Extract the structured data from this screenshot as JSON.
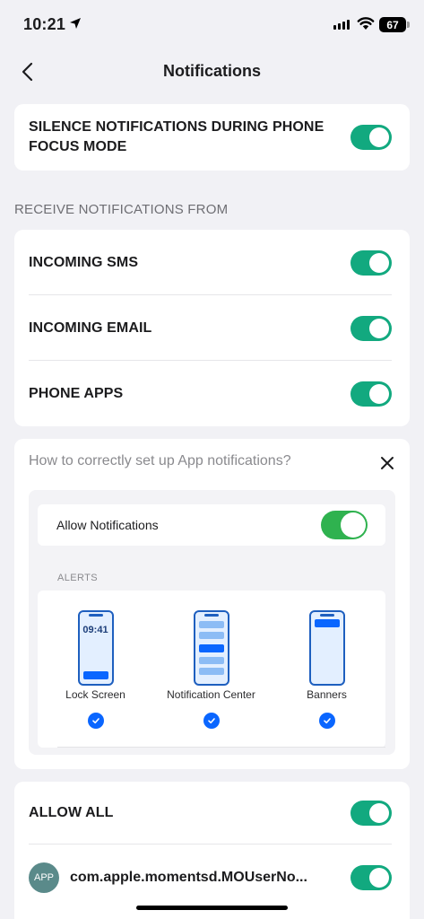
{
  "status_bar": {
    "time": "10:21",
    "battery": "67"
  },
  "nav": {
    "title": "Notifications"
  },
  "focus_mode": {
    "label": "SILENCE NOTIFICATIONS DURING PHONE FOCUS MODE",
    "enabled": true
  },
  "receive_section": {
    "header": "RECEIVE NOTIFICATIONS FROM",
    "items": [
      {
        "label": "INCOMING SMS",
        "enabled": true
      },
      {
        "label": "INCOMING EMAIL",
        "enabled": true
      },
      {
        "label": "PHONE APPS",
        "enabled": true
      }
    ]
  },
  "help_card": {
    "title": "How to correctly set up App notifications?",
    "demo": {
      "allow_label": "Allow Notifications",
      "alerts_header": "ALERTS",
      "options": [
        {
          "label": "Lock Screen",
          "time": "09:41",
          "checked": true
        },
        {
          "label": "Notification Center",
          "checked": true
        },
        {
          "label": "Banners",
          "checked": true
        }
      ]
    }
  },
  "apps_section": {
    "allow_all": {
      "label": "ALLOW ALL",
      "enabled": true
    },
    "apps": [
      {
        "avatar": "APP",
        "label": "com.apple.momentsd.MOUserNo...",
        "enabled": true
      }
    ]
  },
  "colors": {
    "toggle_on": "#12a97f",
    "demo_toggle": "#2fb24f",
    "accent_blue": "#0a66ff",
    "phone_outline": "#1e5fbf"
  }
}
